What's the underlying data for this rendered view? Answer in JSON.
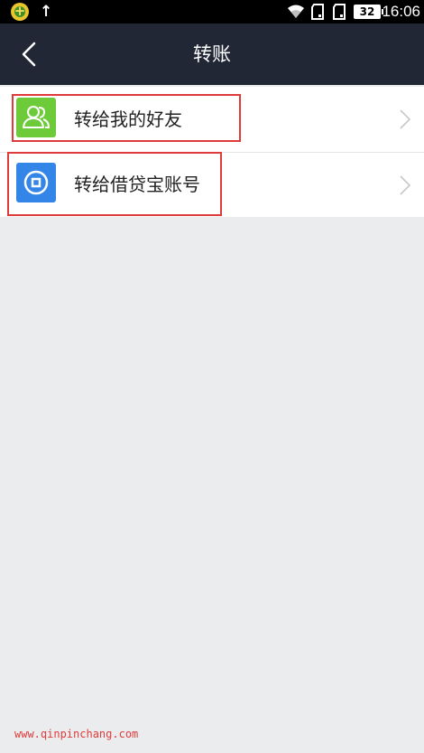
{
  "status_bar": {
    "icons": [
      "app-notification-icon",
      "upload-arrow-icon",
      "wifi-icon",
      "sim1-icon",
      "sim2-icon"
    ],
    "upload_glyph": "↑",
    "battery_level": "32",
    "time": "16:06"
  },
  "header": {
    "title": "转账",
    "back_icon": "chevron-left-icon"
  },
  "list": {
    "items": [
      {
        "label": "转给我的好友",
        "icon": "friends-icon",
        "icon_color": "#6dcb3a"
      },
      {
        "label": "转给借贷宝账号",
        "icon": "coin-icon",
        "icon_color": "#3485e8"
      }
    ]
  },
  "colors": {
    "header_bg": "#212734",
    "page_bg": "#ebecee",
    "highlight": "#e03b3b"
  },
  "watermark": "www.qinpinchang.com"
}
